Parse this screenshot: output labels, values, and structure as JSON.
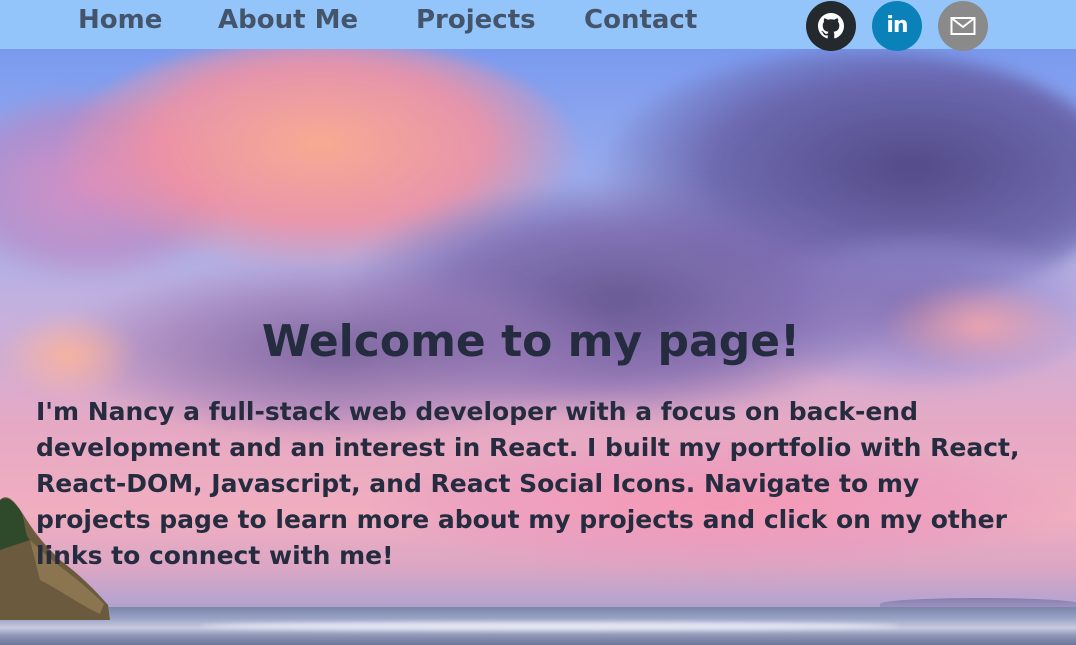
{
  "nav": {
    "links": [
      {
        "label": "Home"
      },
      {
        "label": "About Me"
      },
      {
        "label": "Projects"
      },
      {
        "label": "Contact"
      }
    ],
    "social": [
      {
        "icon": "github-icon",
        "color": "#24292e"
      },
      {
        "icon": "linkedin-icon",
        "color": "#0a81b8",
        "glyph": "in"
      },
      {
        "icon": "mail-icon",
        "color": "#8a8a8a"
      }
    ],
    "background_color": "#93c5fb",
    "link_color": "#44546b"
  },
  "main": {
    "title": "Welcome to my page!",
    "intro": "I'm Nancy a full-stack web developer with a focus on back-end development and an interest in React. I built my portfolio with React, React-DOM, Javascript, and React Social Icons. Navigate to my projects page to learn more about my projects and click on my other links to connect with me!",
    "text_color": "#262c3f"
  },
  "background": {
    "description_icon": "sunset-beach-background"
  }
}
